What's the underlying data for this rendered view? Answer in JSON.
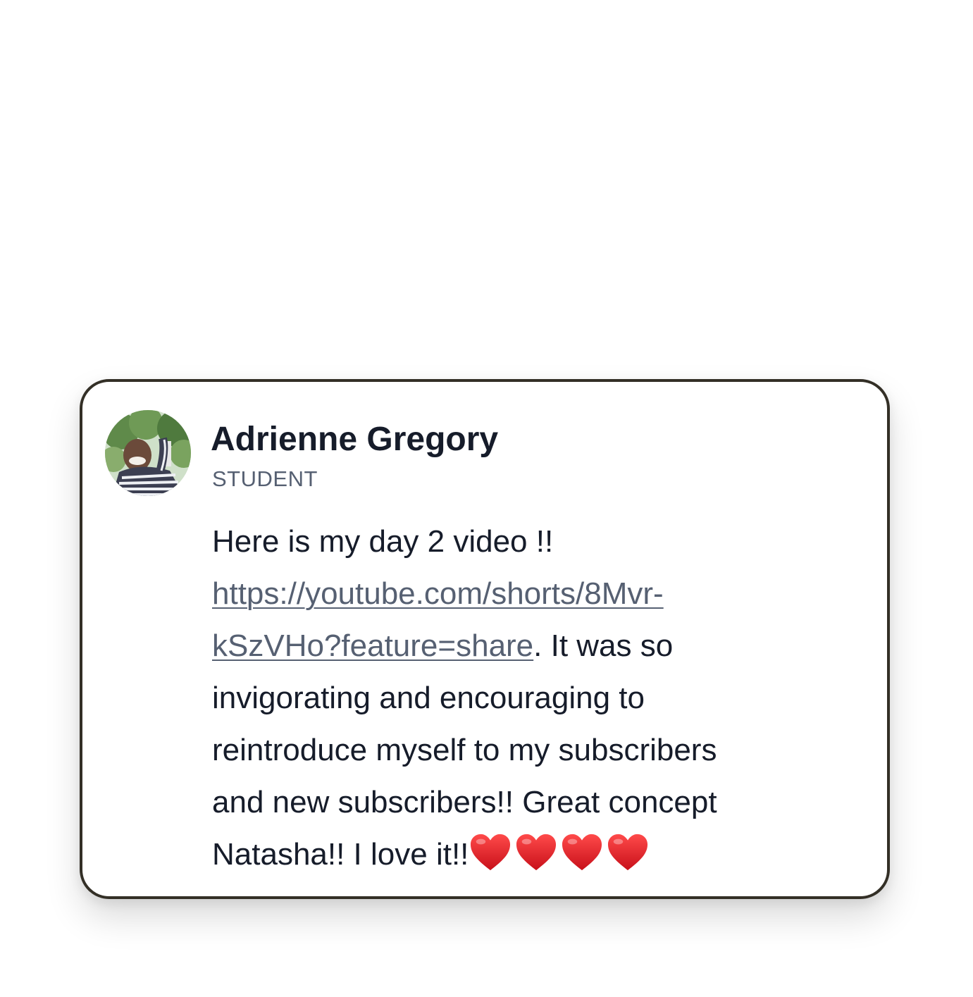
{
  "post": {
    "author": {
      "name": "Adrienne Gregory",
      "role": "STUDENT",
      "avatar_icon": "profile-photo"
    },
    "message": {
      "line1": "Here is my day 2 video !!",
      "link_part1": "https://youtube.com/shorts/8Mvr-",
      "link_part2": "kSzVHo?feature=share",
      "after_link": ". It was so",
      "line4": "invigorating and encouraging to",
      "line5": "reintroduce myself to my subscribers",
      "line6": "and new subscribers!! Great concept",
      "line7": "Natasha!! I love it!!",
      "emoji": "❤️❤️❤️❤️"
    }
  },
  "colors": {
    "text": "#161c2a",
    "muted": "#566072",
    "card_border": "#332f26",
    "heart": "#e0141e"
  }
}
